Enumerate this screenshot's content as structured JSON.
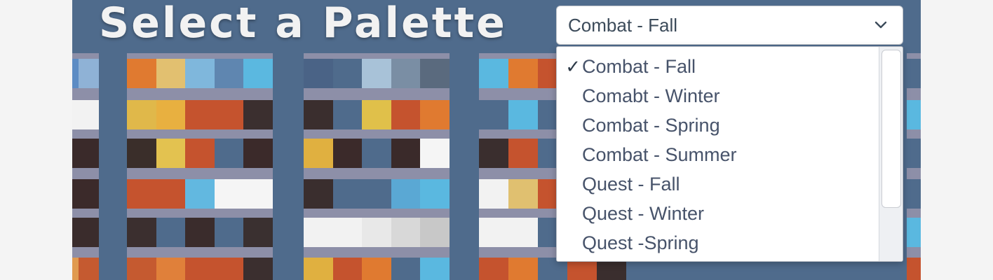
{
  "heading": "Select a Palette",
  "select": {
    "value": "Combat - Fall",
    "options": [
      {
        "label": "Combat - Fall",
        "selected": true
      },
      {
        "label": "Comabt - Winter",
        "selected": false
      },
      {
        "label": "Combat - Spring",
        "selected": false
      },
      {
        "label": "Combat - Summer",
        "selected": false
      },
      {
        "label": "Quest - Fall",
        "selected": false
      },
      {
        "label": "Quest - Winter",
        "selected": false
      },
      {
        "label": "Quest -Spring",
        "selected": false
      }
    ],
    "check_glyph": "✓",
    "chevron_icon": "chevron-down-icon"
  },
  "colors": {
    "background": "#4f6b8c",
    "panel": "#8d8fa8",
    "title": "#f2f2f2"
  },
  "palettes": [
    {
      "rows": [
        [
          "#5d8cc4",
          "#8fb2d6"
        ],
        [
          "#f2f2f2",
          "#f2f2f2"
        ],
        [
          "#3a2a2a",
          "#3a2a2a"
        ],
        [
          "#3b2a2a",
          "#3b2a2a"
        ],
        [
          "#3a2c2c",
          "#3a2c2c"
        ],
        [
          "#e09a50",
          "#c55a30"
        ]
      ]
    },
    {
      "rows": [
        [
          "#e07a30",
          "#e2c070",
          "#7fb7dc",
          "#5f86b0",
          "#5bb8e0"
        ],
        [
          "#e0b84a",
          "#e8b040",
          "#c5532e",
          "#c5532e",
          "#3b2f2f"
        ],
        [
          "#3a2e2a",
          "#e3c250",
          "#c5532e",
          "#4f6b8c",
          "#3b2a2a"
        ],
        [
          "#c5532e",
          "#c5532e",
          "#62b8e0",
          "#f5f5f5",
          "#f5f5f5"
        ],
        [
          "#3b2f2f",
          "#4f6b8c",
          "#3a2c2c",
          "#4f6b8c",
          "#3a3030"
        ],
        [
          "#c55a30",
          "#e0803a",
          "#c5532e",
          "#c5532e",
          "#3b2f2f"
        ]
      ]
    },
    {
      "rows": [
        [
          "#4a6386",
          "#4f6b8c",
          "#a8c2d8",
          "#7a8ea4",
          "#5a6a7e"
        ],
        [
          "#3a2e2e",
          "#4f6b8c",
          "#e0c04a",
          "#c5532e",
          "#e07a30"
        ],
        [
          "#e0b040",
          "#3b2a2a",
          "#4f6b8c",
          "#3a2a2a",
          "#f5f5f5"
        ],
        [
          "#3a2e2e",
          "#4f6b8c",
          "#4f6b8c",
          "#5aa8d4",
          "#5ab8e0"
        ],
        [
          "#f2f2f2",
          "#f2f2f2",
          "#e8e8e8",
          "#d8d8d8",
          "#c8c8c8"
        ],
        [
          "#e0b040",
          "#c5532e",
          "#e07a30",
          "#4f6b8c",
          "#5ab8e0"
        ]
      ]
    },
    {
      "rows": [
        [
          "#5ab8e0",
          "#e07a30",
          "#c5532e",
          "#4f6b8c",
          "#3a2e2e"
        ],
        [
          "#4f6b8c",
          "#5ab8e0",
          "#4f6b8c",
          "#c5532e",
          "#e07a30"
        ],
        [
          "#3a2e2e",
          "#c5532e",
          "#4f6b8c",
          "#3a2e2e",
          "#5ab8e0"
        ],
        [
          "#f2f2f2",
          "#e0c070",
          "#c5532e",
          "#3a2e2e",
          "#c5532e"
        ],
        [
          "#f2f2f2",
          "#f2f2f2",
          "#4f6b8c",
          "#5ab8e0",
          "#3a2e2e"
        ],
        [
          "#c5532e",
          "#e07a30",
          "#4f6b8c",
          "#c5532e",
          "#3a2e2e"
        ]
      ]
    },
    {
      "rows": [
        [
          "#4f6b8c",
          "#3a2e2e"
        ],
        [
          "#5ab8e0",
          "#4f6b8c"
        ],
        [
          "#4f6b8c",
          "#4f8cc4"
        ],
        [
          "#4f6b8c",
          "#c5532e"
        ],
        [
          "#5ab8e0",
          "#4f6b8c"
        ],
        [
          "#c5532e",
          "#3a2e2e"
        ]
      ]
    }
  ]
}
